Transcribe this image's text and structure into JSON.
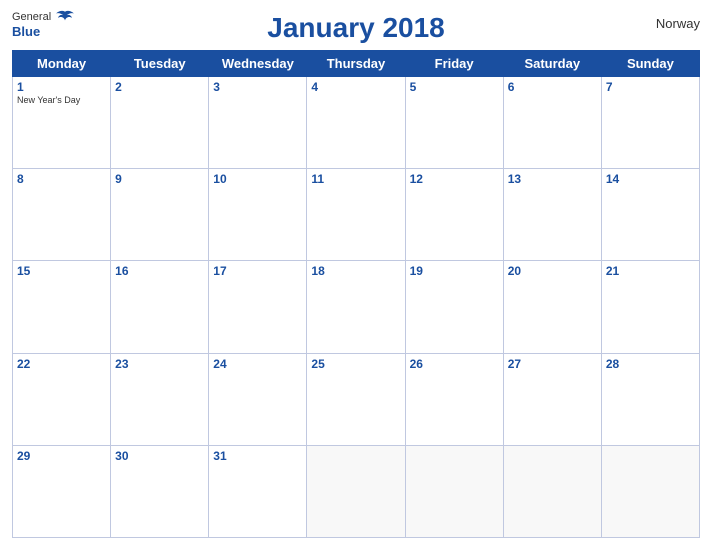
{
  "header": {
    "logo_general": "General",
    "logo_blue": "Blue",
    "title": "January 2018",
    "country": "Norway"
  },
  "days_of_week": [
    "Monday",
    "Tuesday",
    "Wednesday",
    "Thursday",
    "Friday",
    "Saturday",
    "Sunday"
  ],
  "weeks": [
    [
      {
        "day": 1,
        "holiday": "New Year's Day"
      },
      {
        "day": 2
      },
      {
        "day": 3
      },
      {
        "day": 4
      },
      {
        "day": 5
      },
      {
        "day": 6
      },
      {
        "day": 7
      }
    ],
    [
      {
        "day": 8
      },
      {
        "day": 9
      },
      {
        "day": 10
      },
      {
        "day": 11
      },
      {
        "day": 12
      },
      {
        "day": 13
      },
      {
        "day": 14
      }
    ],
    [
      {
        "day": 15
      },
      {
        "day": 16
      },
      {
        "day": 17
      },
      {
        "day": 18
      },
      {
        "day": 19
      },
      {
        "day": 20
      },
      {
        "day": 21
      }
    ],
    [
      {
        "day": 22
      },
      {
        "day": 23
      },
      {
        "day": 24
      },
      {
        "day": 25
      },
      {
        "day": 26
      },
      {
        "day": 27
      },
      {
        "day": 28
      }
    ],
    [
      {
        "day": 29
      },
      {
        "day": 30
      },
      {
        "day": 31
      },
      {
        "day": null
      },
      {
        "day": null
      },
      {
        "day": null
      },
      {
        "day": null
      }
    ]
  ]
}
